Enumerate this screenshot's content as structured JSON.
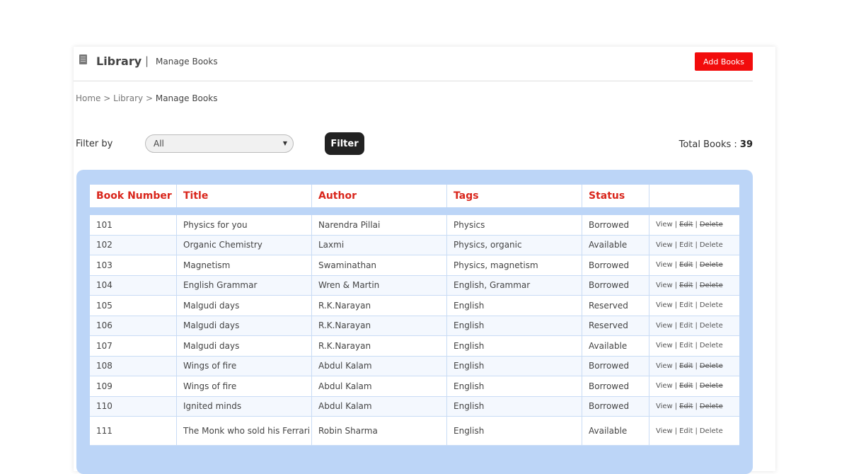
{
  "header": {
    "app_title": "Library",
    "separator": "|",
    "page_subtitle": "Manage Books",
    "add_button_label": "Add Books",
    "icon": "book-icon"
  },
  "breadcrumb": {
    "items": [
      "Home",
      "Library",
      "Manage Books"
    ],
    "separator": ">"
  },
  "filter": {
    "label": "Filter by",
    "selected": "All",
    "button_label": "Filter"
  },
  "total": {
    "label": "Total Books :",
    "value": "39"
  },
  "colors": {
    "accent_red": "#f20c0c",
    "header_text": "#d9261c",
    "table_bg": "#bcd5f7"
  },
  "table": {
    "columns": [
      "Book Number",
      "Title",
      "Author",
      "Tags",
      "Status",
      ""
    ],
    "rows": [
      {
        "number": "101",
        "title": "Physics for you",
        "author": "Narendra Pillai",
        "tags": "Physics",
        "status": "Borrowed",
        "edit_disabled": true
      },
      {
        "number": "102",
        "title": "Organic Chemistry",
        "author": "Laxmi",
        "tags": "Physics, organic",
        "status": "Available",
        "edit_disabled": false
      },
      {
        "number": "103",
        "title": "Magnetism",
        "author": "Swaminathan",
        "tags": "Physics, magnetism",
        "status": "Borrowed",
        "edit_disabled": true
      },
      {
        "number": "104",
        "title": "English Grammar",
        "author": "Wren & Martin",
        "tags": "English, Grammar",
        "status": "Borrowed",
        "edit_disabled": true
      },
      {
        "number": "105",
        "title": "Malgudi days",
        "author": "R.K.Narayan",
        "tags": "English",
        "status": "Reserved",
        "edit_disabled": false
      },
      {
        "number": "106",
        "title": "Malgudi days",
        "author": "R.K.Narayan",
        "tags": "English",
        "status": "Reserved",
        "edit_disabled": false
      },
      {
        "number": "107",
        "title": "Malgudi days",
        "author": "R.K.Narayan",
        "tags": "English",
        "status": "Available",
        "edit_disabled": false
      },
      {
        "number": "108",
        "title": "Wings of fire",
        "author": "Abdul Kalam",
        "tags": "English",
        "status": "Borrowed",
        "edit_disabled": true
      },
      {
        "number": "109",
        "title": "Wings of fire",
        "author": "Abdul Kalam",
        "tags": "English",
        "status": "Borrowed",
        "edit_disabled": true
      },
      {
        "number": "110",
        "title": "Ignited minds",
        "author": "Abdul Kalam",
        "tags": "English",
        "status": "Borrowed",
        "edit_disabled": true
      },
      {
        "number": "111",
        "title": "The Monk who sold his Ferrari",
        "author": "Robin Sharma",
        "tags": "English",
        "status": "Available",
        "edit_disabled": false
      }
    ],
    "actions": {
      "view": "View",
      "edit": "Edit",
      "delete": "Delete",
      "separator": "|"
    }
  }
}
